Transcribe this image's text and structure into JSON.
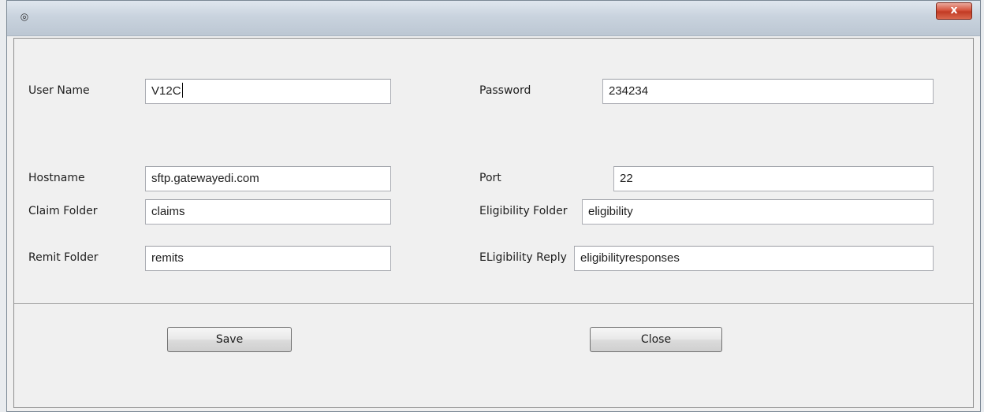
{
  "window": {
    "title_icon": "java-app-icon",
    "close_glyph": "x"
  },
  "form": {
    "user_name": {
      "label": "User Name",
      "value": "V12C"
    },
    "password": {
      "label": "Password",
      "value": "234234"
    },
    "hostname": {
      "label": "Hostname",
      "value": "sftp.gatewayedi.com"
    },
    "port": {
      "label": "Port",
      "value": "22"
    },
    "claim_folder": {
      "label": "Claim Folder",
      "value": "claims"
    },
    "eligibility_folder": {
      "label": "Eligibility Folder",
      "value": "eligibility"
    },
    "remit_folder": {
      "label": "Remit Folder",
      "value": "remits"
    },
    "eligibility_reply": {
      "label": "ELigibility Reply",
      "value": "eligibilityresponses"
    }
  },
  "buttons": {
    "save_label": "Save",
    "close_label": "Close"
  },
  "colors": {
    "close_button": "#c84a33",
    "background": "#f0f0f0"
  }
}
